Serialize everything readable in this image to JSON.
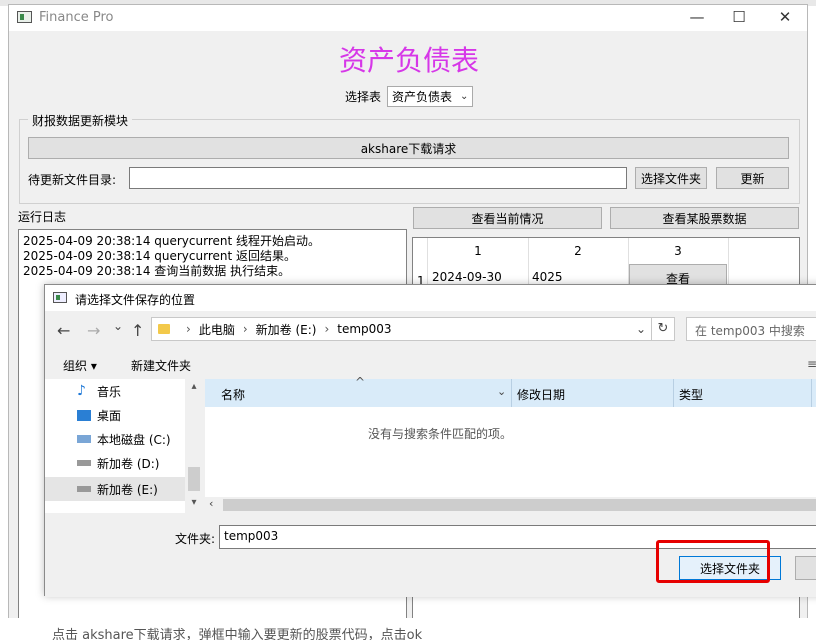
{
  "window": {
    "title": "Finance Pro",
    "minimize": "—",
    "maximize": "☐",
    "close": "✕"
  },
  "header": {
    "title": "资产负债表",
    "select_label": "选择表",
    "select_value": "资产负债表"
  },
  "update_module": {
    "title": "财报数据更新模块",
    "download_button": "akshare下载请求",
    "dir_label": "待更新文件目录:",
    "dir_value": "",
    "choose_folder_button": "选择文件夹",
    "update_button": "更新"
  },
  "log": {
    "title": "运行日志",
    "lines": [
      "2025-04-09 20:38:14 querycurrent 线程开始启动。",
      "2025-04-09 20:38:14 querycurrent 返回结果。",
      "2025-04-09 20:38:14 查询当前数据 执行结束。"
    ]
  },
  "actions": {
    "view_current": "查看当前情况",
    "view_stock": "查看某股票数据"
  },
  "table": {
    "headers": [
      "1",
      "2",
      "3"
    ],
    "rows": [
      {
        "index": "1",
        "col1": "2024-09-30",
        "col2": "4025",
        "col3": "查看"
      }
    ]
  },
  "dialog": {
    "title": "请选择文件保存的位置",
    "back": "←",
    "forward": "→",
    "recent": "⌄",
    "up": "↑",
    "breadcrumb": [
      "此电脑",
      "新加卷 (E:)",
      "temp003"
    ],
    "address_chevron": "⌄",
    "refresh": "↻",
    "search_placeholder": "在 temp003 中搜索",
    "organize": "组织 ▾",
    "new_folder": "新建文件夹",
    "view_options": "≡",
    "nav_items": [
      "音乐",
      "桌面",
      "本地磁盘 (C:)",
      "新加卷 (D:)",
      "新加卷 (E:)"
    ],
    "columns": [
      "名称",
      "修改日期",
      "类型"
    ],
    "empty_message": "没有与搜索条件匹配的项。",
    "folder_label": "文件夹:",
    "folder_value": "temp003",
    "select_button": "选择文件夹",
    "cancel_button": ""
  },
  "footer_text": "点击 akshare下载请求，弹框中输入要更新的股票代码，点击ok"
}
